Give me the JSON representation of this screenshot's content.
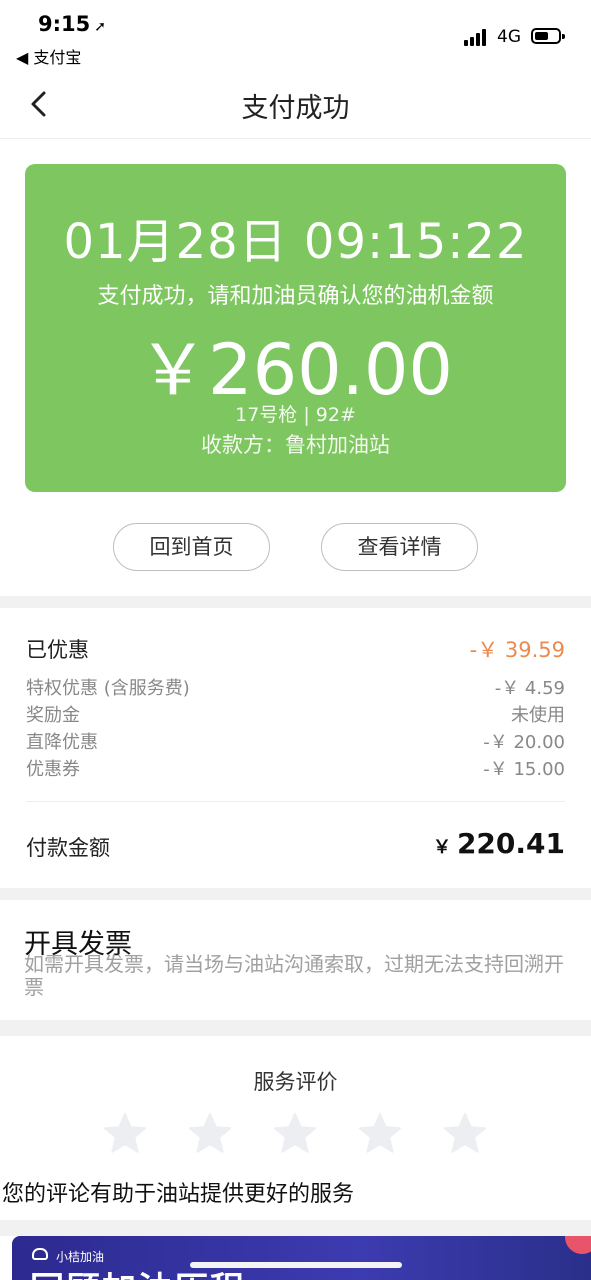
{
  "status_bar": {
    "time": "9:15",
    "location_arrow": "➚",
    "back_app": "◀ 支付宝",
    "network": "4G"
  },
  "nav": {
    "title": "支付成功",
    "back_icon": "chevron-left-icon"
  },
  "result": {
    "datetime": "01月28日 09:15:22",
    "message": "支付成功，请和加油员确认您的油机金额",
    "amount": "￥260.00",
    "pump": "17号枪 | 92#",
    "payee": "收款方：鲁村加油站",
    "card_color": "#7dc660"
  },
  "actions": {
    "home": "回到首页",
    "detail": "查看详情"
  },
  "discount": {
    "title": "已优惠",
    "total": "-￥ 39.59",
    "total_color": "#ec8a4e",
    "rows": [
      {
        "label": "特权优惠 (含服务费)",
        "value": "-￥ 4.59"
      },
      {
        "label": "奖励金",
        "value": "未使用"
      },
      {
        "label": "直降优惠",
        "value": "-￥ 20.00"
      },
      {
        "label": "优惠券",
        "value": "-￥ 15.00"
      }
    ]
  },
  "payment": {
    "label": "付款金额",
    "currency": "￥",
    "amount": "220.41"
  },
  "invoice": {
    "title": "开具发票",
    "desc": "如需开具发票，请当场与油站沟通索取，过期无法支持回溯开票"
  },
  "rating": {
    "title": "服务评价",
    "stars_total": 5,
    "stars_selected": 0,
    "note": "您的评论有助于油站提供更好的服务"
  },
  "banner": {
    "logo": "小桔加油",
    "text": "回顾加油历程"
  }
}
